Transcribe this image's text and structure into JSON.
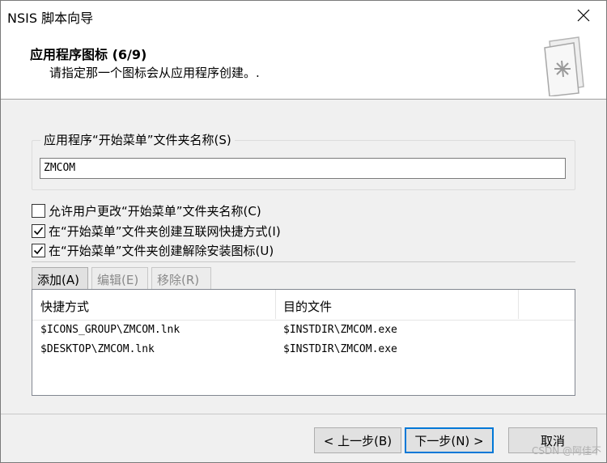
{
  "window": {
    "title": "NSIS 脚本向导"
  },
  "header": {
    "title": "应用程序图标 (6/9)",
    "subtitle": "请指定那一个图标会从应用程序创建。."
  },
  "folder_group": {
    "legend": "应用程序“开始菜单”文件夹名称(S)",
    "value": "ZMCOM"
  },
  "options": [
    {
      "label": "允许用户更改“开始菜单”文件夹名称(C)",
      "checked": false
    },
    {
      "label": "在“开始菜单”文件夹创建互联网快捷方式(I)",
      "checked": true
    },
    {
      "label": "在“开始菜单”文件夹创建解除安装图标(U)",
      "checked": true
    }
  ],
  "list_toolbar": {
    "add": "添加(A)",
    "edit": "编辑(E)",
    "remove": "移除(R)"
  },
  "shortcut_table": {
    "columns": [
      "快捷方式",
      "目的文件"
    ],
    "rows": [
      [
        "$ICONS_GROUP\\ZMCOM.lnk",
        "$INSTDIR\\ZMCOM.exe"
      ],
      [
        "$DESKTOP\\ZMCOM.lnk",
        "$INSTDIR\\ZMCOM.exe"
      ]
    ]
  },
  "footer": {
    "back": "< 上一步(B)",
    "next": "下一步(N) >",
    "cancel": "取消"
  },
  "watermark": "CSDN @阿佳不",
  "colors": {
    "accent": "#0078d7",
    "window_bg": "#f0f0f0",
    "header_bg": "#ffffff"
  }
}
